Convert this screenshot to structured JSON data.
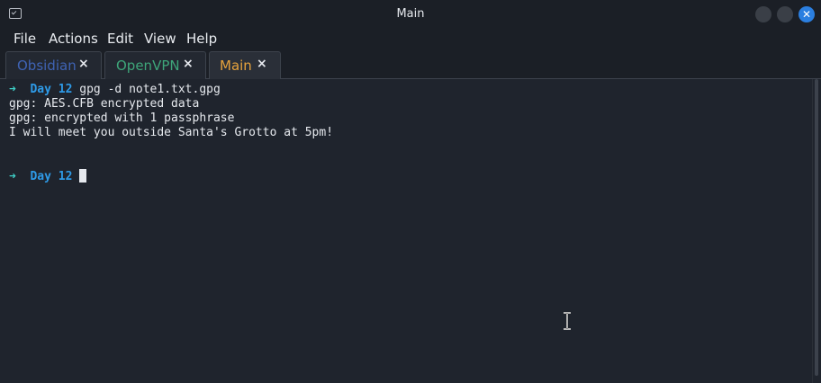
{
  "window": {
    "title": "Main"
  },
  "menu": [
    "File",
    "Actions",
    "Edit",
    "View",
    "Help"
  ],
  "tabs": [
    {
      "label": "Obsidian",
      "color": "#3f63b4",
      "close": "×"
    },
    {
      "label": "OpenVPN",
      "color": "#3ea67a",
      "close": "×"
    },
    {
      "label": "Main",
      "color": "#e6a23c",
      "close": "×"
    }
  ],
  "terminal": {
    "prompt_arrow": "➜",
    "prompt_dir": "Day 12",
    "command": "gpg -d note1.txt.gpg",
    "output": [
      "gpg: AES.CFB encrypted data",
      "gpg: encrypted with 1 passphrase",
      "I will meet you outside Santa's Grotto at 5pm!"
    ]
  },
  "colors": {
    "background": "#1f242d",
    "prompt_arrow": "#3fd0c7",
    "prompt_dir": "#2e9be8",
    "close_button": "#2b7fe0"
  }
}
